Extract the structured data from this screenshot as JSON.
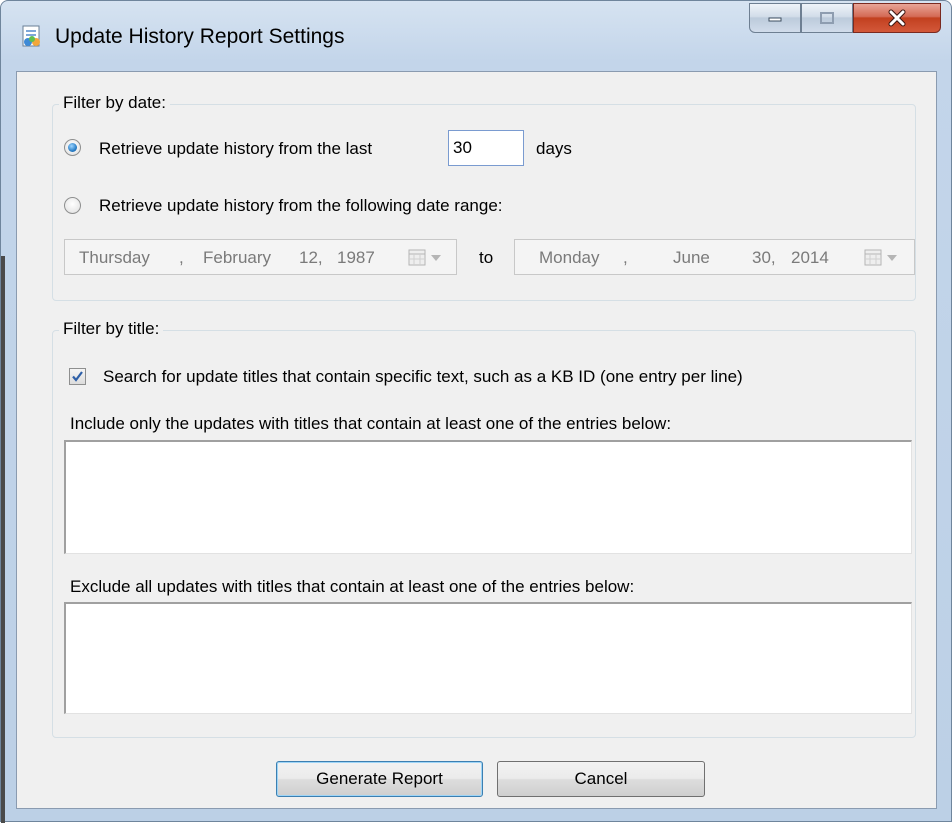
{
  "window": {
    "title": "Update History Report Settings",
    "icons": {
      "app": "report-settings-icon",
      "minimize": "minimize-icon",
      "maximize": "maximize-icon",
      "close": "close-icon"
    }
  },
  "filter_by_date": {
    "legend": "Filter by date:",
    "last_days": {
      "selected": true,
      "label_before": "Retrieve update history from the last",
      "value": "30",
      "label_after": "days"
    },
    "date_range": {
      "selected": false,
      "label": "Retrieve update history from the following date range:",
      "from": {
        "weekday": "Thursday",
        "month": "February",
        "day": "12,",
        "year": "1987"
      },
      "separator": "to",
      "to": {
        "weekday": "Monday",
        "month": "June",
        "day": "30,",
        "year": "2014"
      }
    }
  },
  "filter_by_title": {
    "legend": "Filter by title:",
    "search_checkbox": {
      "checked": true,
      "label": "Search for update titles that contain specific text, such as a KB ID (one entry per line)"
    },
    "include_label": "Include only the updates with titles that contain at least one of the entries below:",
    "include_value": "",
    "exclude_label": "Exclude all updates with titles that contain at least one of the entries below:",
    "exclude_value": ""
  },
  "buttons": {
    "generate": "Generate Report",
    "cancel": "Cancel"
  },
  "colors": {
    "radio_selected": "#2a7fc8",
    "close_button": "#c2401f",
    "focus_border": "#7a9bd0"
  }
}
